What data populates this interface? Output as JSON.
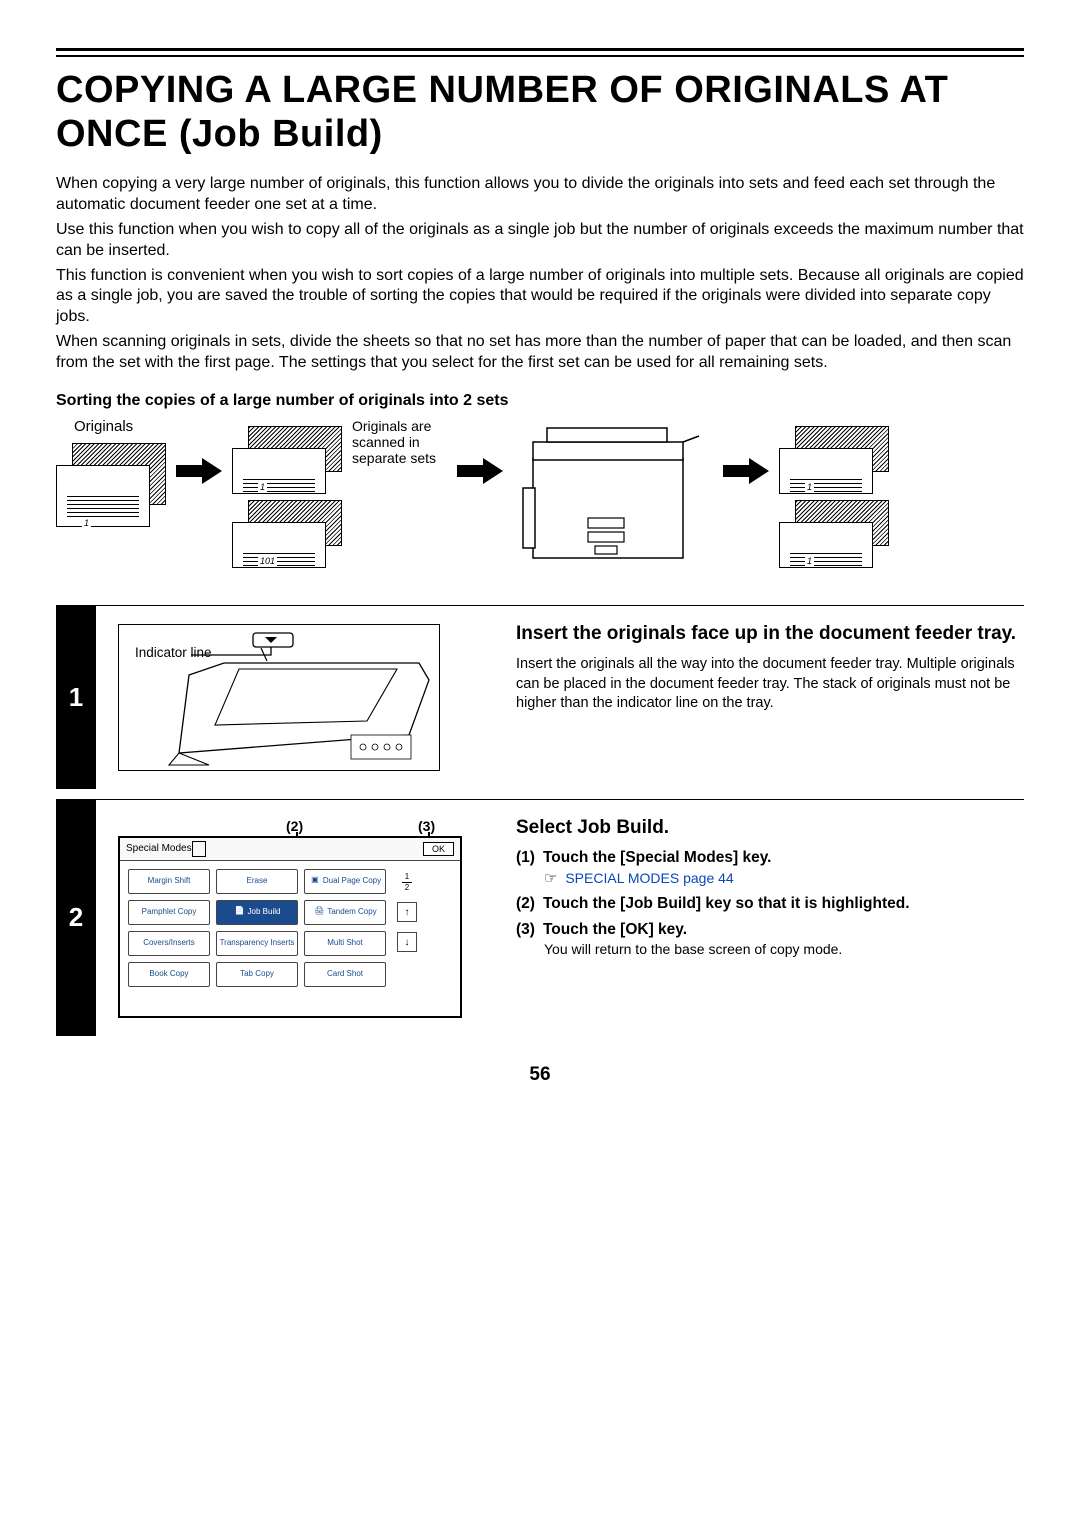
{
  "heading": "COPYING A LARGE NUMBER OF ORIGINALS AT ONCE (Job Build)",
  "para1": "When copying a very large number of originals, this function allows you to divide the originals into sets and feed each set through the automatic document feeder one set at a time.",
  "para2": "Use this function when you wish to copy all of the originals as a single job but the number of originals exceeds the maximum number that can be inserted.",
  "para3": "This function is convenient when you wish to sort copies of a large number of originals into multiple sets. Because all originals are copied as a single job, you are saved the trouble of sorting the copies that would be required if the originals were divided into separate copy jobs.",
  "para4": "When scanning originals in sets, divide the sheets so that no set has more than the number of paper that can be loaded, and then scan from the set with the first page. The settings that you select for the first set can be used for all remaining sets.",
  "subheading": "Sorting the copies of a large number of originals into 2 sets",
  "diag": {
    "originals_label": "Originals",
    "scan_label": "Originals are scanned in separate sets",
    "p1": "1",
    "p101": "101"
  },
  "step1": {
    "num": "1",
    "indicator": "Indicator line",
    "title": "Insert the originals face up in the document feeder tray.",
    "body": "Insert the originals all the way into the document feeder tray. Multiple originals can be placed in the document feeder tray. The stack of originals must not be higher than the indicator line on the tray."
  },
  "step2": {
    "num": "2",
    "callout2": "(2)",
    "callout3": "(3)",
    "panel": {
      "title": "Special Modes",
      "ok": "OK",
      "keys": {
        "r1c1": "Margin Shift",
        "r1c2": "Erase",
        "r1c3": "Dual Page Copy",
        "r2c1": "Pamphlet Copy",
        "r2c2": "Job Build",
        "r2c3": "Tandem Copy",
        "r3c1": "Covers/Inserts",
        "r3c2": "Transparency Inserts",
        "r3c3": "Multi Shot",
        "r4c1": "Book Copy",
        "r4c2": "Tab Copy",
        "r4c3": "Card Shot"
      },
      "frac_top": "1",
      "frac_bot": "2"
    },
    "title": "Select Job Build.",
    "inst1_num": "(1)",
    "inst1": "Touch the [Special Modes] key.",
    "inst1_link": "SPECIAL MODES page 44",
    "inst2_num": "(2)",
    "inst2": "Touch the [Job Build] key so that it is highlighted.",
    "inst3_num": "(3)",
    "inst3": "Touch the [OK] key.",
    "inst3_body": "You will return to the base screen of copy mode."
  },
  "page_number": "56"
}
